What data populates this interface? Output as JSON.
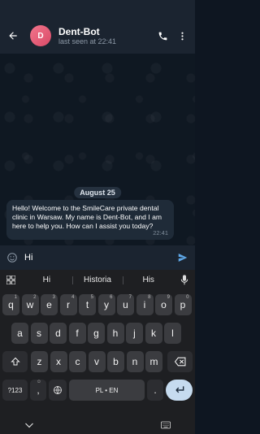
{
  "chat": {
    "name": "Dent-Bot",
    "status": "last seen at 22:41",
    "avatar_letter": "D",
    "date_separator": "August 25",
    "message": {
      "text": "Hello! Welcome to the SmileCare private dental clinic in Warsaw. My name is Dent-Bot, and I am here to help you. How can I assist you today?",
      "time": "22:41"
    }
  },
  "composer": {
    "value": "Hi"
  },
  "keyboard": {
    "suggestions": [
      "Hi",
      "Historia",
      "His"
    ],
    "row1": [
      [
        "q",
        "1"
      ],
      [
        "w",
        "2"
      ],
      [
        "e",
        "3"
      ],
      [
        "r",
        "4"
      ],
      [
        "t",
        "5"
      ],
      [
        "y",
        "6"
      ],
      [
        "u",
        "7"
      ],
      [
        "i",
        "8"
      ],
      [
        "o",
        "9"
      ],
      [
        "p",
        "0"
      ]
    ],
    "row2": [
      "a",
      "s",
      "d",
      "f",
      "g",
      "h",
      "j",
      "k",
      "l"
    ],
    "row3": [
      "z",
      "x",
      "c",
      "v",
      "b",
      "n",
      "m"
    ],
    "symbols_label": "?123",
    "comma_label": ",",
    "space_label": "PL • EN",
    "period_label": "."
  },
  "colors": {
    "app_bar": "#1b2430",
    "chat_bg": "#0f1822",
    "bubble": "#1f2b38",
    "accent": "#5fa8e8",
    "enter_key": "#c6dbef"
  },
  "icons": [
    "arrow-left-icon",
    "phone-icon",
    "more-vertical-icon",
    "emoji-icon",
    "send-icon",
    "grid-icon",
    "mic-icon",
    "shift-icon",
    "backspace-icon",
    "globe-icon",
    "enter-icon",
    "chevron-down-icon",
    "keyboard-icon"
  ]
}
